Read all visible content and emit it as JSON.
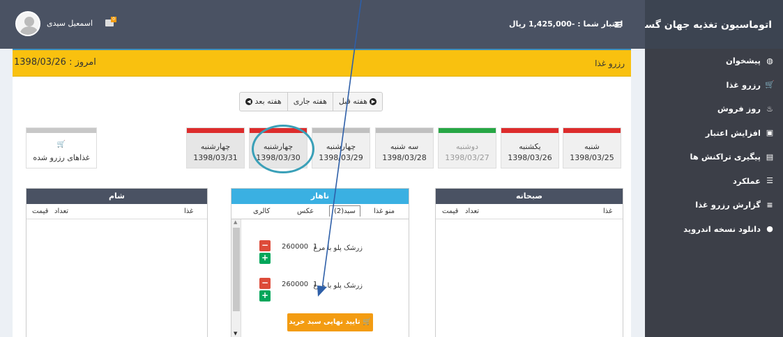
{
  "app": {
    "title": "اتوماسیون تغذیه جهان گستر"
  },
  "topbar": {
    "credit": "اعتبار شما : -1,425,000 ریال",
    "username": "اسمعیل سیدی",
    "notify_badge": "0"
  },
  "sidebar": {
    "items": [
      {
        "label": "پیشخوان",
        "icon": "dashboard-icon",
        "glyph": "◍"
      },
      {
        "label": "رزرو غذا",
        "icon": "cart-icon",
        "glyph": "🛒"
      },
      {
        "label": "روز فروش",
        "icon": "flame-icon",
        "glyph": "♨"
      },
      {
        "label": "افزایش اعتبار",
        "icon": "money-icon",
        "glyph": "▣"
      },
      {
        "label": "پیگیری تراکنش ها",
        "icon": "receipt-icon",
        "glyph": "▤"
      },
      {
        "label": "عملکرد",
        "icon": "list-icon",
        "glyph": "☰"
      },
      {
        "label": "گزارش رزرو غذا",
        "icon": "report-icon",
        "glyph": "≡"
      },
      {
        "label": "دانلود نسخه اندروید",
        "icon": "android-icon",
        "glyph": "●"
      }
    ]
  },
  "page": {
    "title": "رزرو غذا",
    "today": "امروز : 1398/03/26"
  },
  "weeknav": {
    "prev": "هفته قبل",
    "current": "هفته جاری",
    "next": "هفته بعد"
  },
  "days": [
    {
      "name": "شنبه",
      "date": "1398/03/25",
      "status_color": "#dd2c2c"
    },
    {
      "name": "یکشنبه",
      "date": "1398/03/26",
      "status_color": "#dd2c2c"
    },
    {
      "name": "دوشنبه",
      "date": "1398/03/27",
      "status_color": "#27a745"
    },
    {
      "name": "سه شنبه",
      "date": "1398/03/28",
      "status_color": "#c0c0c0"
    },
    {
      "name": "چهارشنبه",
      "date": "1398/03/29",
      "status_color": "#c0c0c0"
    },
    {
      "name": "چهارشنبه",
      "date": "1398/03/30",
      "status_color": "#dd2c2c"
    },
    {
      "name": "چهارشنبه",
      "date": "1398/03/31",
      "status_color": "#dd2c2c"
    }
  ],
  "reserved_tab": "غذاهای رزرو شده",
  "meals": {
    "breakfast": {
      "title": "صبحانه",
      "col_food": "غذا",
      "col_qty": "تعداد",
      "col_price": "قیمت"
    },
    "dinner": {
      "title": "شام",
      "col_food": "غذا",
      "col_qty": "تعداد",
      "col_price": "قیمت"
    },
    "lunch": {
      "title": "ناهار",
      "tabs": {
        "menu": "منو غذا",
        "cart": "سبد(2)",
        "photo": "عکس",
        "calorie": "کالری"
      },
      "items": [
        {
          "name": "زرشک پلو با مرغ",
          "qty": "1",
          "price": "260000"
        },
        {
          "name": "زرشک پلو با مرغ",
          "qty": "1",
          "price": "260000"
        }
      ],
      "confirm": "تایید نهایی سبد خرید"
    }
  },
  "colors": {
    "accent": "#3c8dbc",
    "title_bar": "#f9c10f",
    "sidebar": "#3c3f48",
    "topbar": "#4a5263"
  }
}
